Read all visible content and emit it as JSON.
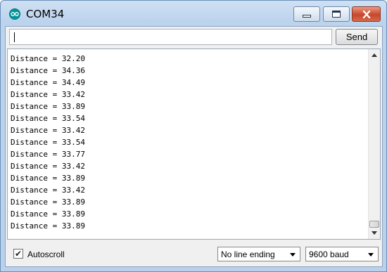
{
  "window": {
    "title": "COM34",
    "icon": "arduino-logo-icon"
  },
  "input": {
    "value": "",
    "send_label": "Send"
  },
  "output": {
    "lines": [
      "Distance = 32.20",
      "Distance = 34.36",
      "Distance = 34.49",
      "Distance = 33.42",
      "Distance = 33.89",
      "Distance = 33.54",
      "Distance = 33.42",
      "Distance = 33.54",
      "Distance = 33.77",
      "Distance = 33.42",
      "Distance = 33.89",
      "Distance = 33.42",
      "Distance = 33.89",
      "Distance = 33.89",
      "Distance = 33.89"
    ]
  },
  "footer": {
    "autoscroll_label": "Autoscroll",
    "autoscroll_checked": true,
    "line_ending": "No line ending",
    "baud_rate": "9600 baud"
  },
  "colors": {
    "close_button": "#c8462a",
    "titlebar": "#bcd3ee"
  }
}
